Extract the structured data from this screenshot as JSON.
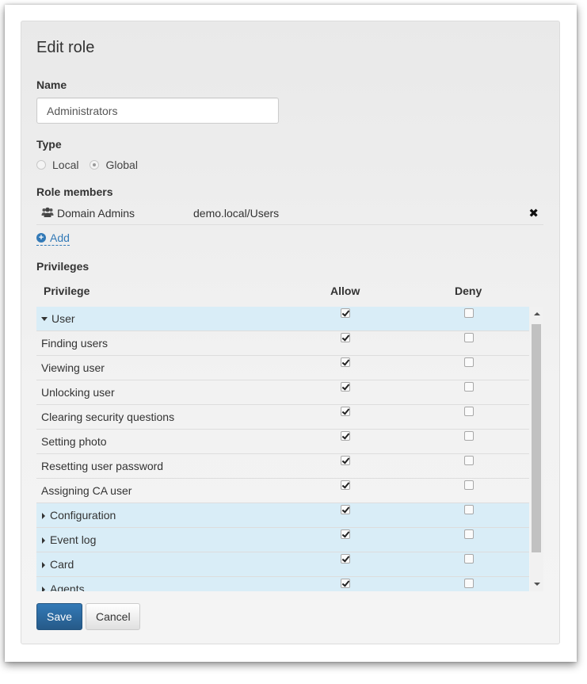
{
  "dialog": {
    "title": "Edit role"
  },
  "name": {
    "label": "Name",
    "value": "Administrators"
  },
  "type": {
    "label": "Type",
    "options": [
      {
        "label": "Local",
        "checked": false
      },
      {
        "label": "Global",
        "checked": true
      }
    ]
  },
  "members": {
    "label": "Role members",
    "items": [
      {
        "name": "Domain Admins",
        "path": "demo.local/Users",
        "icon": "users-icon"
      }
    ],
    "remove_glyph": "✖",
    "add_label": "Add"
  },
  "privileges": {
    "label": "Privileges",
    "columns": {
      "privilege": "Privilege",
      "allow": "Allow",
      "deny": "Deny"
    },
    "rows": [
      {
        "label": "User",
        "group": true,
        "expanded": true,
        "allow": true,
        "deny": false
      },
      {
        "label": "Finding users",
        "group": false,
        "allow": true,
        "deny": false
      },
      {
        "label": "Viewing user",
        "group": false,
        "allow": true,
        "deny": false
      },
      {
        "label": "Unlocking user",
        "group": false,
        "allow": true,
        "deny": false
      },
      {
        "label": "Clearing security questions",
        "group": false,
        "allow": true,
        "deny": false
      },
      {
        "label": "Setting photo",
        "group": false,
        "allow": true,
        "deny": false
      },
      {
        "label": "Resetting user password",
        "group": false,
        "allow": true,
        "deny": false
      },
      {
        "label": "Assigning CA user",
        "group": false,
        "allow": true,
        "deny": false
      },
      {
        "label": "Configuration",
        "group": true,
        "expanded": false,
        "allow": true,
        "deny": false
      },
      {
        "label": "Event log",
        "group": true,
        "expanded": false,
        "allow": true,
        "deny": false
      },
      {
        "label": "Card",
        "group": true,
        "expanded": false,
        "allow": true,
        "deny": false
      },
      {
        "label": "Agents",
        "group": true,
        "expanded": false,
        "allow": true,
        "deny": false
      }
    ]
  },
  "buttons": {
    "save": "Save",
    "cancel": "Cancel"
  },
  "colors": {
    "primary": "#337ab7",
    "group_row": "#d9edf7"
  }
}
